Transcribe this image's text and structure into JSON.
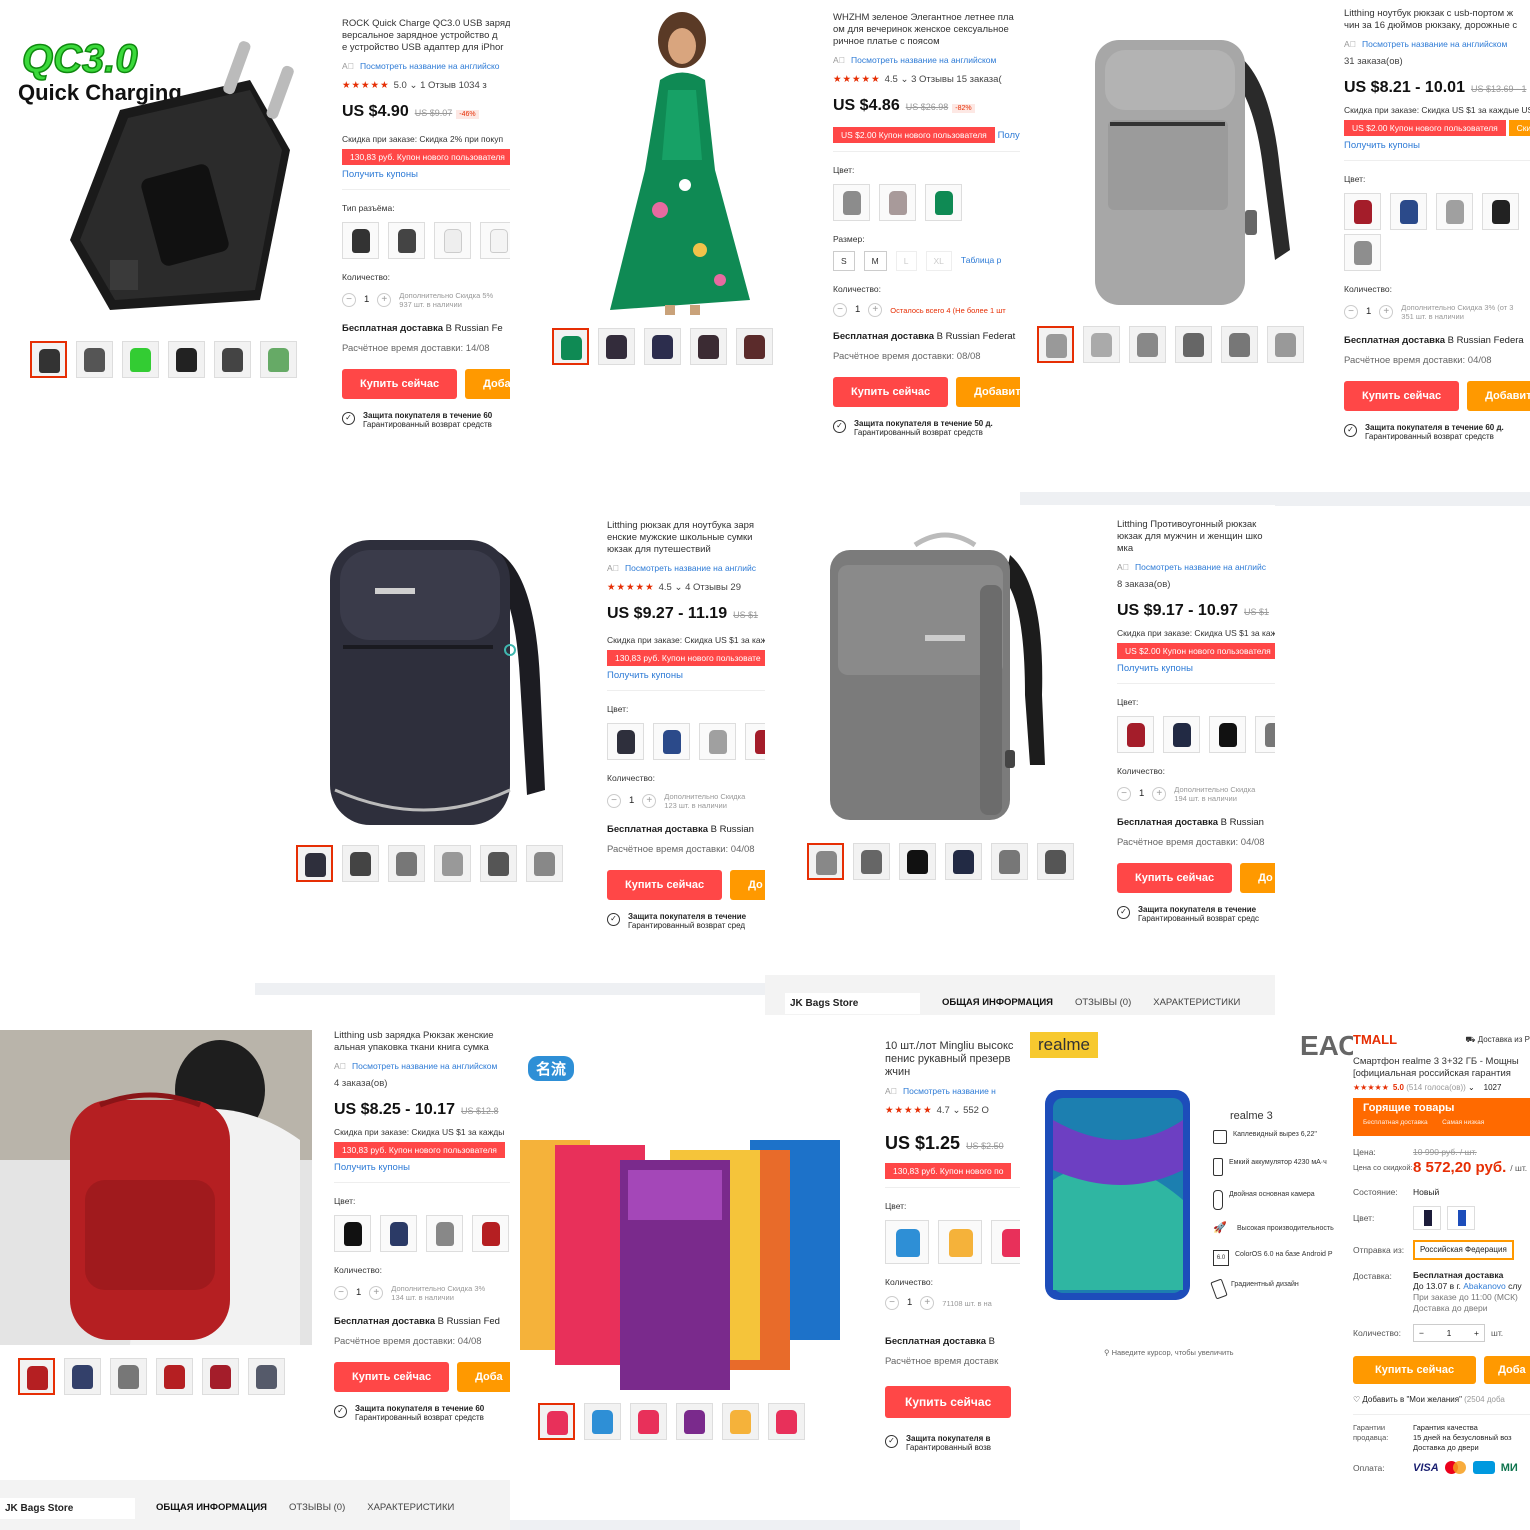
{
  "p1": {
    "overlay_logo": "QC3.0",
    "overlay_text": "Quick Charging",
    "title": [
      "ROCK Quick Charge QC3.0 USB заряд",
      "версальное зарядное устройство д",
      "е устройство USB адаптер для iPhor"
    ],
    "translate": "Посмотреть название на английско",
    "rating": "5.0",
    "rating_tail": "1 Отзыв   1034 з",
    "price": "US $4.90",
    "old": "US $9.07",
    "disc": "-46%",
    "sale": "Скидка при заказе: Скидка 2% при покуп",
    "coupon": "130,83 руб. Купон нового пользователя",
    "get": "Получить купоны",
    "option_label": "Тип разъёма:",
    "qty_label": "Количество:",
    "qty": "1",
    "stock": [
      "Дополнительно Скидка 5%",
      "937 шт. в наличии"
    ],
    "ship_bold": "Бесплатная доставка",
    "ship_rest": " В Russian Fe",
    "eta": "Расчётное время доставки: 14/08",
    "buy": "Купить сейчас",
    "add": "Доба",
    "prot": [
      "Защита покупателя в течение 60",
      "Гарантированный возврат средств"
    ]
  },
  "p2": {},
  "p3": {
    "title": [
      "WHZHM зеленое Элегантное летнее пла",
      "ом для вечеринок женское сексуальное",
      "ричное платье с поясом"
    ],
    "translate": "Посмотреть название на английском",
    "rating": "4.5",
    "rating_tail": "3 Отзывы   15 заказа(",
    "price": "US $4.86",
    "old": "US $26.98",
    "disc": "-82%",
    "coupon": "US $2.00 Купон нового пользователя",
    "coupon_tail": "Полу",
    "color_label": "Цвет:",
    "size_label": "Размер:",
    "sizes": [
      "S",
      "M",
      "L",
      "XL"
    ],
    "size_table": "Таблица р",
    "qty_label": "Количество:",
    "qty": "1",
    "stock": [
      "Осталось всего 4 (Не более 1 шт"
    ],
    "ship_bold": "Бесплатная доставка",
    "ship_rest": " В Russian Federat",
    "eta": "Расчётное время доставки: 08/08",
    "buy": "Купить сейчас",
    "add": "Добавить",
    "prot": [
      "Защита покупателя в течение 50 д.",
      "Гарантированный возврат средств"
    ]
  },
  "p4": {
    "title": [
      "Litthing ноутбук рюкзак с usb-портом ж",
      "чин за 16 дюймов рюкзаку, дорожные с"
    ],
    "translate": "Посмотреть название на английском",
    "orders": "31 заказа(ов)",
    "price": "US $8.21 - 10.01",
    "old": "US $13.69 - 1",
    "sale": "Скидка при заказе: Скидка US $1 за каждые US",
    "coupon": "US $2.00 Купон нового пользователя",
    "coupon_tail": "Скид",
    "get": "Получить купоны",
    "color_label": "Цвет:",
    "qty_label": "Количество:",
    "qty": "1",
    "stock": [
      "Дополнительно Скидка 3% (от 3",
      "351 шт. в наличии"
    ],
    "ship_bold": "Бесплатная доставка",
    "ship_rest": " В Russian Federa",
    "eta": "Расчётное время доставки: 04/08",
    "buy": "Купить сейчас",
    "add": "Добавить",
    "prot": [
      "Защита покупателя в течение 60 д.",
      "Гарантированный возврат средств"
    ]
  },
  "p5": {
    "title": [
      "Litthing рюкзак для ноутбука заря",
      "енские мужские школьные сумки",
      "юкзак для путешествий"
    ],
    "translate": "Посмотреть название на английс",
    "rating": "4.5",
    "rating_tail": "4 Отзывы   29",
    "price": "US $9.27 - 11.19",
    "old": "US $1",
    "sale": "Скидка при заказе: Скидка US $1 за каж",
    "coupon": "130,83 руб. Купон нового пользовате",
    "get": "Получить купоны",
    "color_label": "Цвет:",
    "qty_label": "Количество:",
    "qty": "1",
    "stock": [
      "Дополнительно Скидка",
      "123 шт. в наличии"
    ],
    "ship_bold": "Бесплатная доставка",
    "ship_rest": " В Russian",
    "eta": "Расчётное время доставки: 04/08",
    "buy": "Купить сейчас",
    "add": "До",
    "prot": [
      "Защита покупателя в течение",
      "Гарантированный возврат сред"
    ]
  },
  "p6": {
    "title": [
      "Litthing Противоугонный рюкзак",
      "юкзак для мужчин и женщин шко",
      "мка"
    ],
    "translate": "Посмотреть название на английс",
    "orders": "8 заказа(ов)",
    "price": "US $9.17 - 10.97",
    "old": "US $1",
    "sale": "Скидка при заказе: Скидка US $1 за каж",
    "coupon": "US $2.00 Купон нового пользователя",
    "get": "Получить купоны",
    "color_label": "Цвет:",
    "qty_label": "Количество:",
    "qty": "1",
    "stock": [
      "Дополнительно Скидка",
      "194 шт. в наличии"
    ],
    "ship_bold": "Бесплатная доставка",
    "ship_rest": " В Russian",
    "eta": "Расчётное время доставки: 04/08",
    "buy": "Купить сейчас",
    "add": "До",
    "prot": [
      "Защита покупателя в течение",
      "Гарантированный возврат средс"
    ],
    "store": "JK Bags Store",
    "tabs": [
      "ОБЩАЯ ИНФОРМАЦИЯ",
      "ОТЗЫВЫ (0)",
      "ХАРАКТЕРИСТИКИ"
    ]
  },
  "p7": {
    "title": [
      "Litthing usb зарядка Рюкзак женские",
      "альная упаковка ткани книга сумка"
    ],
    "translate": "Посмотреть название на английском",
    "orders": "4 заказа(ов)",
    "price": "US $8.25 - 10.17",
    "old": "US $12.8",
    "sale": "Скидка при заказе: Скидка US $1 за кажды",
    "coupon": "130,83 руб. Купон нового пользователя",
    "get": "Получить купоны",
    "color_label": "Цвет:",
    "qty_label": "Количество:",
    "qty": "1",
    "stock": [
      "Дополнительно Скидка 3%",
      "134 шт. в наличии"
    ],
    "ship_bold": "Бесплатная доставка",
    "ship_rest": " В Russian Fed",
    "eta": "Расчётное время доставки: 04/08",
    "buy": "Купить сейчас",
    "add": "Доба",
    "prot": [
      "Защита покупателя в течение 60",
      "Гарантированный возврат средств"
    ],
    "store": "JK Bags Store",
    "tabs": [
      "ОБЩАЯ ИНФОРМАЦИЯ",
      "ОТЗЫВЫ (0)",
      "ХАРАКТЕРИСТИКИ"
    ]
  },
  "p8": {
    "brand": "名流",
    "title": [
      "10 шт./лот Mingliu высокс",
      "пенис рукавный презерв",
      "жчин"
    ],
    "translate": "Посмотреть название н",
    "rating": "4.7",
    "rating_tail": "552 О",
    "price": "US $1.25",
    "old": "US $2.50",
    "coupon": "130,83 руб. Купон нового по",
    "color_label": "Цвет:",
    "qty_label": "Количество:",
    "qty": "1",
    "stock": [
      "71108 шт. в на"
    ],
    "ship_bold": "Бесплатная доставка",
    "ship_rest": " В",
    "eta": "Расчётное время доставк",
    "buy": "Купить сейчас",
    "prot": [
      "Защита покупателя в",
      "Гарантированный возв"
    ]
  },
  "p9": {
    "brand": "realme",
    "cert": "ЕАС",
    "model": "realme 3",
    "features": [
      "Каплевидный вырез 6,22\"",
      "Емкий аккумулятор 4230 мА·ч",
      "Двойная основная камера",
      "Высокая производительность",
      "ColorOS 6.0 на базе Android P",
      "Градиентный дизайн"
    ],
    "zoom": "Наведите курсор, чтобы увеличить",
    "tmall": "TMALL",
    "delivery_from": "Доставка из Р",
    "title": [
      "Смартфон realme 3 3+32 ГБ - Мощны",
      "[официальная российская гарантия"
    ],
    "rating": "5.0",
    "votes": "(514 голоса(ов))",
    "orders": "1027",
    "hot": "Горящие товары",
    "hot_sub1": "Бесплатная доставка",
    "hot_sub2": "Самая низкая",
    "price_label": "Цена:",
    "price_old": "10 990 руб. / шт.",
    "sale_label": "Цена со скидкой:",
    "price": "8 572,20 руб.",
    "price_unit": "/ шт.",
    "cond_label": "Состояние:",
    "cond": "Новый",
    "color_label": "Цвет:",
    "from_label": "Отправка из:",
    "from": "Российская Федерация",
    "deliv_label": "Доставка:",
    "deliv": "Бесплатная доставка",
    "deliv2": "До 13.07 в г.",
    "deliv_city": "Abakanovo",
    "deliv2_tail": " слу",
    "deliv3": "При заказе до 11:00 (МСК)",
    "deliv4": "Доставка до двери",
    "qty_label": "Количество:",
    "qty": "1",
    "qty_unit": "шт.",
    "buy": "Купить сейчас",
    "add": "Доба",
    "wish": "Добавить в \"Мои желания\"",
    "wish_n": "(2504 доба",
    "guar_label": "Гарантии продавца:",
    "guar": [
      "Гарантия качества",
      "15 дней на безусловный воз",
      "Доставка до двери"
    ],
    "pay_label": "Оплата:",
    "pay": [
      "VISA",
      "МИ"
    ]
  }
}
